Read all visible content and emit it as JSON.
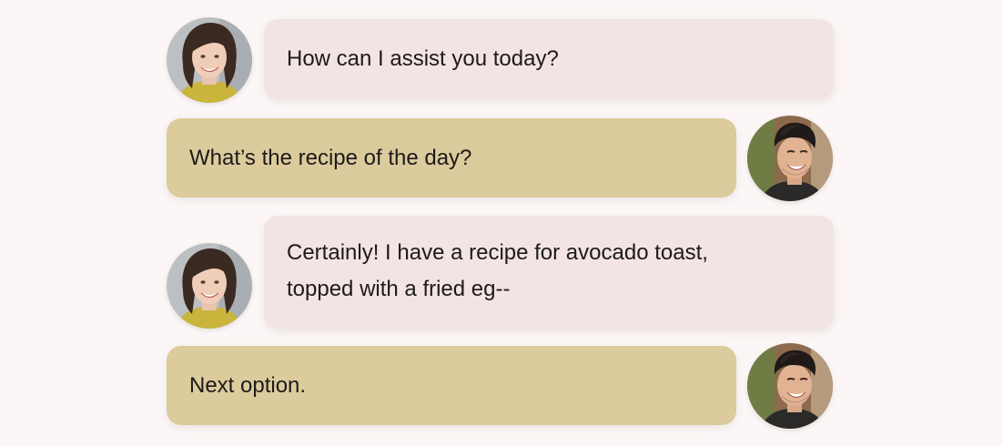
{
  "conversation": {
    "messages": [
      {
        "role": "assistant",
        "text": "How can I assist you today?"
      },
      {
        "role": "user",
        "text": "What’s the recipe of the day?"
      },
      {
        "role": "assistant",
        "line1": "Certainly! I have a recipe for avocado toast,",
        "line2": "topped with a fried eg--"
      },
      {
        "role": "user",
        "text": "Next option."
      }
    ]
  },
  "colors": {
    "page_background": "#fcf7f6",
    "assistant_bubble": "#f2e4e2",
    "user_bubble": "#dccb9c",
    "text": "#1d1a1a"
  },
  "icons": {
    "assistant_avatar": "woman-avatar",
    "user_avatar": "man-avatar"
  }
}
